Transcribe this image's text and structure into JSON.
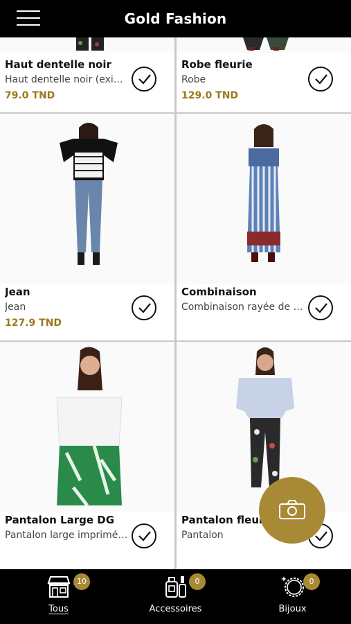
{
  "header": {
    "title": "Gold Fashion"
  },
  "products": [
    {
      "name": "Haut dentelle noir",
      "description": "Haut dentelle noir (existe en blanc)",
      "price": "79.0 TND"
    },
    {
      "name": "Robe fleurie",
      "description": "Robe",
      "price": "129.0 TND"
    },
    {
      "name": "Jean",
      "description": "Jean",
      "price": "127.9 TND"
    },
    {
      "name": "Combinaison",
      "description": "Combinaison rayée de blanc",
      "price": ""
    },
    {
      "name": "Pantalon Large DG",
      "description": "Pantalon large imprimé palmes",
      "price": ""
    },
    {
      "name": "Pantalon fleuri",
      "description": "Pantalon",
      "price": ""
    }
  ],
  "tabs": [
    {
      "label": "Tous",
      "badge": "10",
      "icon": "shop-icon"
    },
    {
      "label": "Accessoires",
      "badge": "0",
      "icon": "accessories-icon"
    },
    {
      "label": "Bijoux",
      "badge": "0",
      "icon": "necklace-icon"
    }
  ],
  "colors": {
    "accent": "#a88a36",
    "price": "#9a7a1a",
    "bar": "#000000"
  }
}
